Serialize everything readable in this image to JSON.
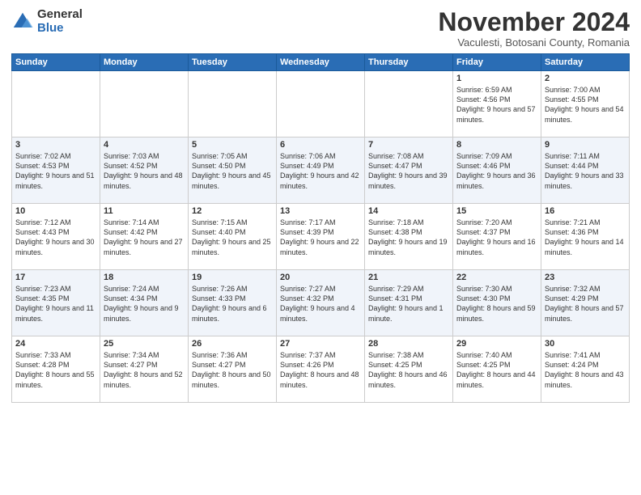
{
  "logo": {
    "general": "General",
    "blue": "Blue"
  },
  "title": "November 2024",
  "subtitle": "Vaculesti, Botosani County, Romania",
  "days_header": [
    "Sunday",
    "Monday",
    "Tuesday",
    "Wednesday",
    "Thursday",
    "Friday",
    "Saturday"
  ],
  "weeks": [
    [
      {
        "day": "",
        "info": ""
      },
      {
        "day": "",
        "info": ""
      },
      {
        "day": "",
        "info": ""
      },
      {
        "day": "",
        "info": ""
      },
      {
        "day": "",
        "info": ""
      },
      {
        "day": "1",
        "info": "Sunrise: 6:59 AM\nSunset: 4:56 PM\nDaylight: 9 hours and 57 minutes."
      },
      {
        "day": "2",
        "info": "Sunrise: 7:00 AM\nSunset: 4:55 PM\nDaylight: 9 hours and 54 minutes."
      }
    ],
    [
      {
        "day": "3",
        "info": "Sunrise: 7:02 AM\nSunset: 4:53 PM\nDaylight: 9 hours and 51 minutes."
      },
      {
        "day": "4",
        "info": "Sunrise: 7:03 AM\nSunset: 4:52 PM\nDaylight: 9 hours and 48 minutes."
      },
      {
        "day": "5",
        "info": "Sunrise: 7:05 AM\nSunset: 4:50 PM\nDaylight: 9 hours and 45 minutes."
      },
      {
        "day": "6",
        "info": "Sunrise: 7:06 AM\nSunset: 4:49 PM\nDaylight: 9 hours and 42 minutes."
      },
      {
        "day": "7",
        "info": "Sunrise: 7:08 AM\nSunset: 4:47 PM\nDaylight: 9 hours and 39 minutes."
      },
      {
        "day": "8",
        "info": "Sunrise: 7:09 AM\nSunset: 4:46 PM\nDaylight: 9 hours and 36 minutes."
      },
      {
        "day": "9",
        "info": "Sunrise: 7:11 AM\nSunset: 4:44 PM\nDaylight: 9 hours and 33 minutes."
      }
    ],
    [
      {
        "day": "10",
        "info": "Sunrise: 7:12 AM\nSunset: 4:43 PM\nDaylight: 9 hours and 30 minutes."
      },
      {
        "day": "11",
        "info": "Sunrise: 7:14 AM\nSunset: 4:42 PM\nDaylight: 9 hours and 27 minutes."
      },
      {
        "day": "12",
        "info": "Sunrise: 7:15 AM\nSunset: 4:40 PM\nDaylight: 9 hours and 25 minutes."
      },
      {
        "day": "13",
        "info": "Sunrise: 7:17 AM\nSunset: 4:39 PM\nDaylight: 9 hours and 22 minutes."
      },
      {
        "day": "14",
        "info": "Sunrise: 7:18 AM\nSunset: 4:38 PM\nDaylight: 9 hours and 19 minutes."
      },
      {
        "day": "15",
        "info": "Sunrise: 7:20 AM\nSunset: 4:37 PM\nDaylight: 9 hours and 16 minutes."
      },
      {
        "day": "16",
        "info": "Sunrise: 7:21 AM\nSunset: 4:36 PM\nDaylight: 9 hours and 14 minutes."
      }
    ],
    [
      {
        "day": "17",
        "info": "Sunrise: 7:23 AM\nSunset: 4:35 PM\nDaylight: 9 hours and 11 minutes."
      },
      {
        "day": "18",
        "info": "Sunrise: 7:24 AM\nSunset: 4:34 PM\nDaylight: 9 hours and 9 minutes."
      },
      {
        "day": "19",
        "info": "Sunrise: 7:26 AM\nSunset: 4:33 PM\nDaylight: 9 hours and 6 minutes."
      },
      {
        "day": "20",
        "info": "Sunrise: 7:27 AM\nSunset: 4:32 PM\nDaylight: 9 hours and 4 minutes."
      },
      {
        "day": "21",
        "info": "Sunrise: 7:29 AM\nSunset: 4:31 PM\nDaylight: 9 hours and 1 minute."
      },
      {
        "day": "22",
        "info": "Sunrise: 7:30 AM\nSunset: 4:30 PM\nDaylight: 8 hours and 59 minutes."
      },
      {
        "day": "23",
        "info": "Sunrise: 7:32 AM\nSunset: 4:29 PM\nDaylight: 8 hours and 57 minutes."
      }
    ],
    [
      {
        "day": "24",
        "info": "Sunrise: 7:33 AM\nSunset: 4:28 PM\nDaylight: 8 hours and 55 minutes."
      },
      {
        "day": "25",
        "info": "Sunrise: 7:34 AM\nSunset: 4:27 PM\nDaylight: 8 hours and 52 minutes."
      },
      {
        "day": "26",
        "info": "Sunrise: 7:36 AM\nSunset: 4:27 PM\nDaylight: 8 hours and 50 minutes."
      },
      {
        "day": "27",
        "info": "Sunrise: 7:37 AM\nSunset: 4:26 PM\nDaylight: 8 hours and 48 minutes."
      },
      {
        "day": "28",
        "info": "Sunrise: 7:38 AM\nSunset: 4:25 PM\nDaylight: 8 hours and 46 minutes."
      },
      {
        "day": "29",
        "info": "Sunrise: 7:40 AM\nSunset: 4:25 PM\nDaylight: 8 hours and 44 minutes."
      },
      {
        "day": "30",
        "info": "Sunrise: 7:41 AM\nSunset: 4:24 PM\nDaylight: 8 hours and 43 minutes."
      }
    ]
  ]
}
